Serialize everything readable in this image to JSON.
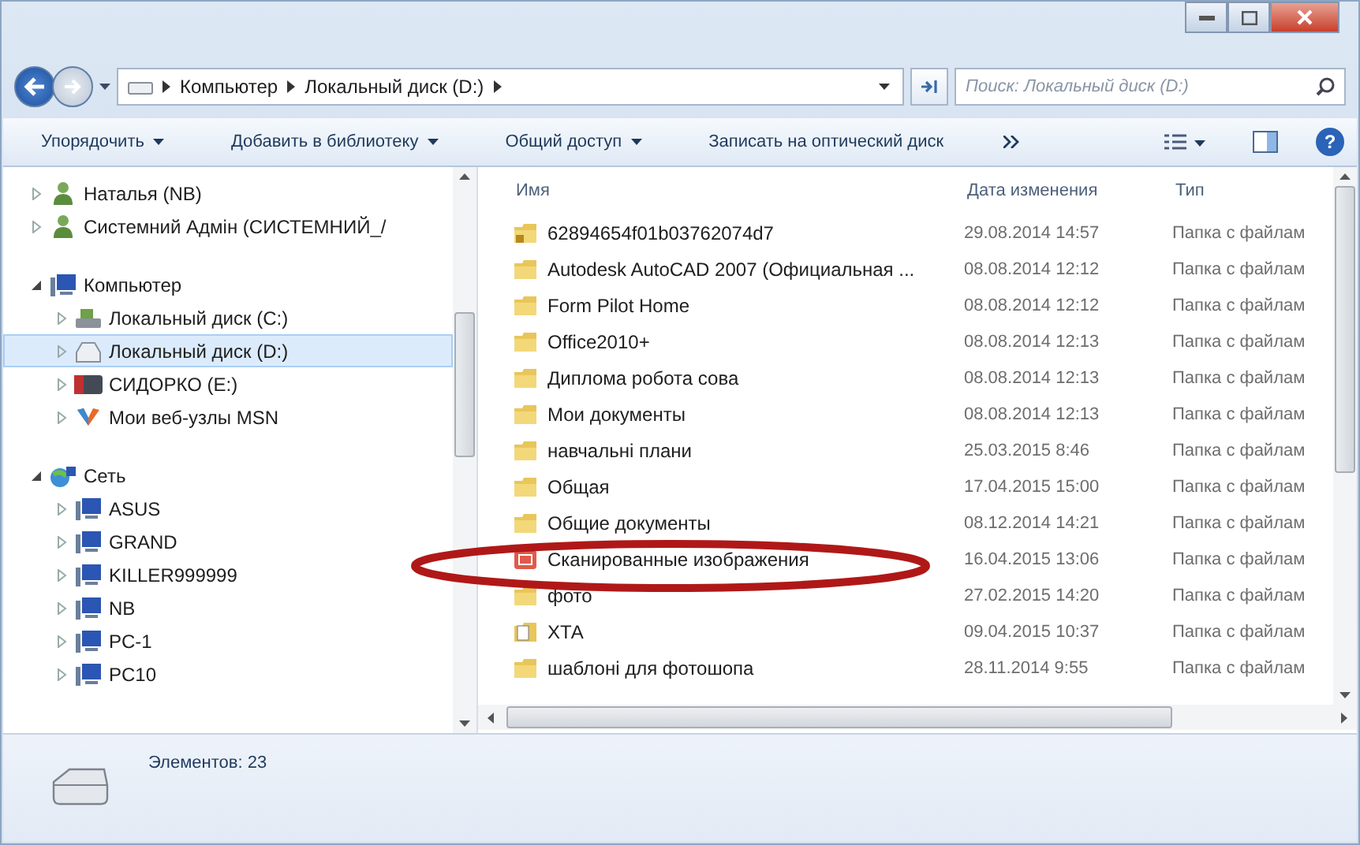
{
  "address_bar": {
    "breadcrumbs": [
      "Компьютер",
      "Локальный диск (D:)"
    ]
  },
  "search": {
    "placeholder": "Поиск: Локальный диск (D:)"
  },
  "toolbar": {
    "buttons": [
      {
        "label": "Упорядочить",
        "dropdown": true
      },
      {
        "label": "Добавить в библиотеку",
        "dropdown": true
      },
      {
        "label": "Общий доступ",
        "dropdown": true
      },
      {
        "label": "Записать на оптический диск",
        "dropdown": false
      }
    ]
  },
  "nav": {
    "items": [
      {
        "label": "Наталья (NB)",
        "kind": "user",
        "expanded": false,
        "selected": false
      },
      {
        "label": "Системний Адмін (СИСТЕМНИЙ_/",
        "kind": "user",
        "expanded": false,
        "selected": false
      },
      {
        "label": "Компьютер",
        "kind": "computer",
        "expanded": true,
        "selected": false,
        "children": [
          {
            "label": "Локальный диск (C:)",
            "kind": "system-drive",
            "expanded": false,
            "selected": false
          },
          {
            "label": "Локальный диск (D:)",
            "kind": "drive",
            "expanded": false,
            "selected": true
          },
          {
            "label": "СИДОРКО (E:)",
            "kind": "usb",
            "expanded": false,
            "selected": false
          },
          {
            "label": "Мои веб-узлы MSN",
            "kind": "msn",
            "expanded": false,
            "selected": false
          }
        ]
      },
      {
        "label": "Сеть",
        "kind": "network",
        "expanded": true,
        "selected": false,
        "children": [
          {
            "label": "ASUS",
            "kind": "pc",
            "expanded": false,
            "selected": false
          },
          {
            "label": "GRAND",
            "kind": "pc",
            "expanded": false,
            "selected": false
          },
          {
            "label": "KILLER999999",
            "kind": "pc",
            "expanded": false,
            "selected": false
          },
          {
            "label": "NB",
            "kind": "pc",
            "expanded": false,
            "selected": false
          },
          {
            "label": "PC-1",
            "kind": "pc",
            "expanded": false,
            "selected": false
          },
          {
            "label": "PC10",
            "kind": "pc",
            "expanded": false,
            "selected": false
          }
        ]
      }
    ]
  },
  "files": {
    "columns": [
      "Имя",
      "Дата изменения",
      "Тип"
    ],
    "rows": [
      {
        "name": "62894654f01b03762074d7",
        "date": "29.08.2014 14:57",
        "type": "Папка с файлам",
        "kind": "locked-folder",
        "circled": false
      },
      {
        "name": "Autodesk AutoCAD 2007 (Официальная ...",
        "date": "08.08.2014 12:12",
        "type": "Папка с файлам",
        "kind": "folder",
        "circled": false
      },
      {
        "name": "Form Pilot Home",
        "date": "08.08.2014 12:12",
        "type": "Папка с файлам",
        "kind": "folder",
        "circled": false
      },
      {
        "name": "Office2010+",
        "date": "08.08.2014 12:13",
        "type": "Папка с файлам",
        "kind": "folder",
        "circled": false
      },
      {
        "name": "Диплома робота сова",
        "date": "08.08.2014 12:13",
        "type": "Папка с файлам",
        "kind": "folder",
        "circled": false
      },
      {
        "name": "Мои документы",
        "date": "08.08.2014 12:13",
        "type": "Папка с файлам",
        "kind": "folder",
        "circled": false
      },
      {
        "name": "навчальні плани",
        "date": "25.03.2015 8:46",
        "type": "Папка с файлам",
        "kind": "folder",
        "circled": false
      },
      {
        "name": "Общая",
        "date": "17.04.2015 15:00",
        "type": "Папка с файлам",
        "kind": "folder",
        "circled": false
      },
      {
        "name": "Общие документы",
        "date": "08.12.2014 14:21",
        "type": "Папка с файлам",
        "kind": "folder",
        "circled": false
      },
      {
        "name": "Сканированные изображения",
        "date": "16.04.2015 13:06",
        "type": "Папка с файлам",
        "kind": "scan-folder",
        "circled": true
      },
      {
        "name": "фото",
        "date": "27.02.2015 14:20",
        "type": "Папка с файлам",
        "kind": "folder",
        "circled": false
      },
      {
        "name": "ХТА",
        "date": "09.04.2015 10:37",
        "type": "Папка с файлам",
        "kind": "document-folder",
        "circled": false
      },
      {
        "name": "шаблоні для фотошопа",
        "date": "28.11.2014 9:55",
        "type": "Папка с файлам",
        "kind": "folder",
        "circled": false
      }
    ]
  },
  "help_button": {
    "label": "?"
  },
  "status_bar": {
    "text": "Элементов: 23"
  }
}
